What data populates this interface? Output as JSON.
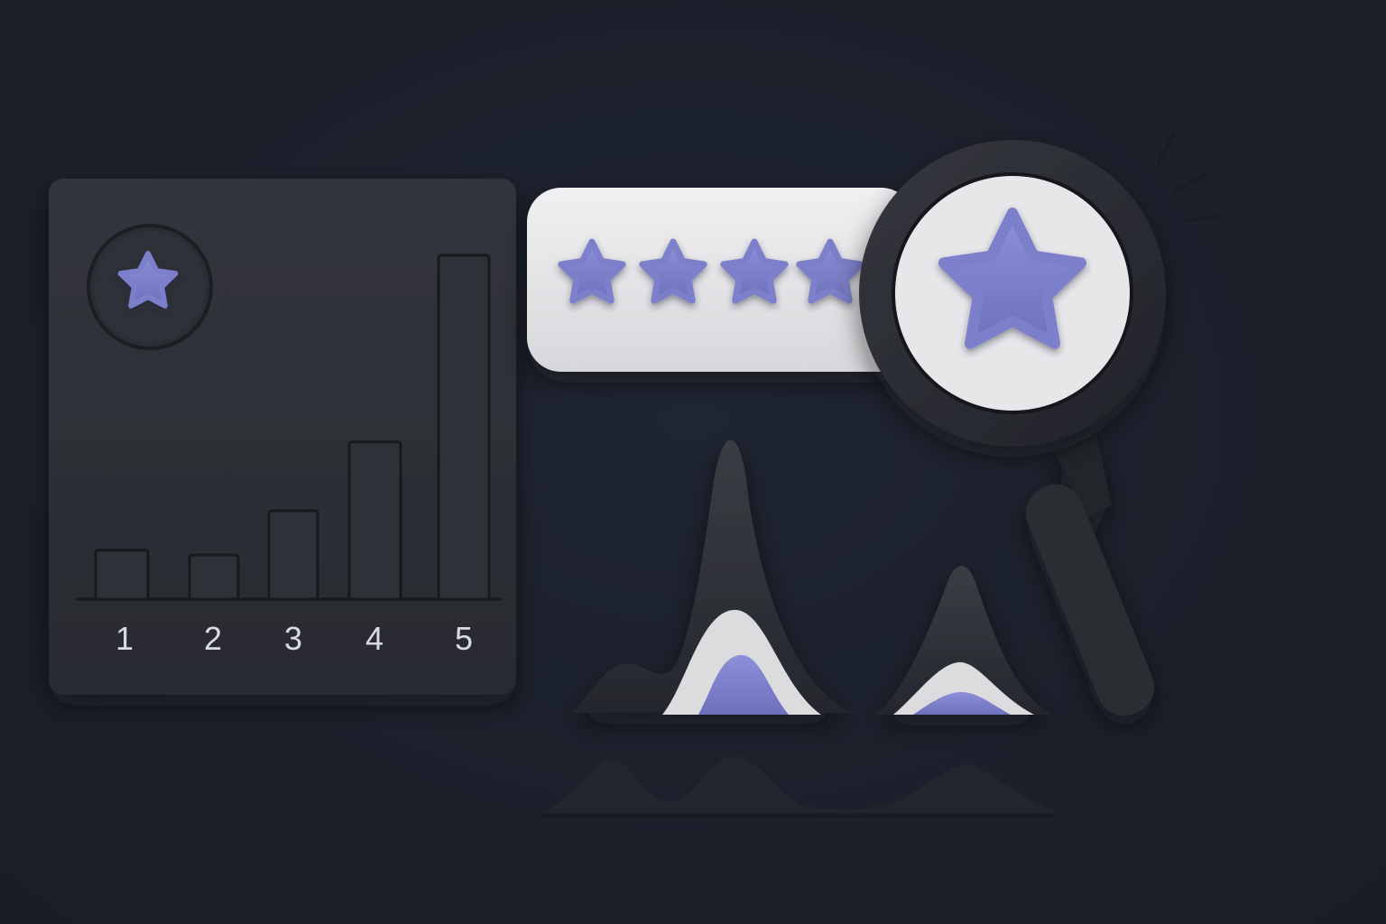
{
  "colors": {
    "background": "#1c212c",
    "card": "#2c2f36",
    "accent_purple": "#7c7fc9",
    "pill_light": "#e6e6e8",
    "magnifier_ring": "#2a2c32"
  },
  "icons": {
    "card_badge": "star-icon",
    "rating_stars": "star-icon",
    "magnifier": "magnifying-glass-icon",
    "magnifier_center": "star-icon"
  },
  "rating": {
    "stars_shown": 4,
    "highlighted_stars": 1
  },
  "chart_data": {
    "type": "bar",
    "categories": [
      "1",
      "2",
      "3",
      "4",
      "5"
    ],
    "values": [
      1,
      0.9,
      1.8,
      3.2,
      7.0
    ],
    "title": "",
    "xlabel": "",
    "ylabel": "",
    "ylim": [
      0,
      7.2
    ],
    "grid": false,
    "legend": "none"
  }
}
